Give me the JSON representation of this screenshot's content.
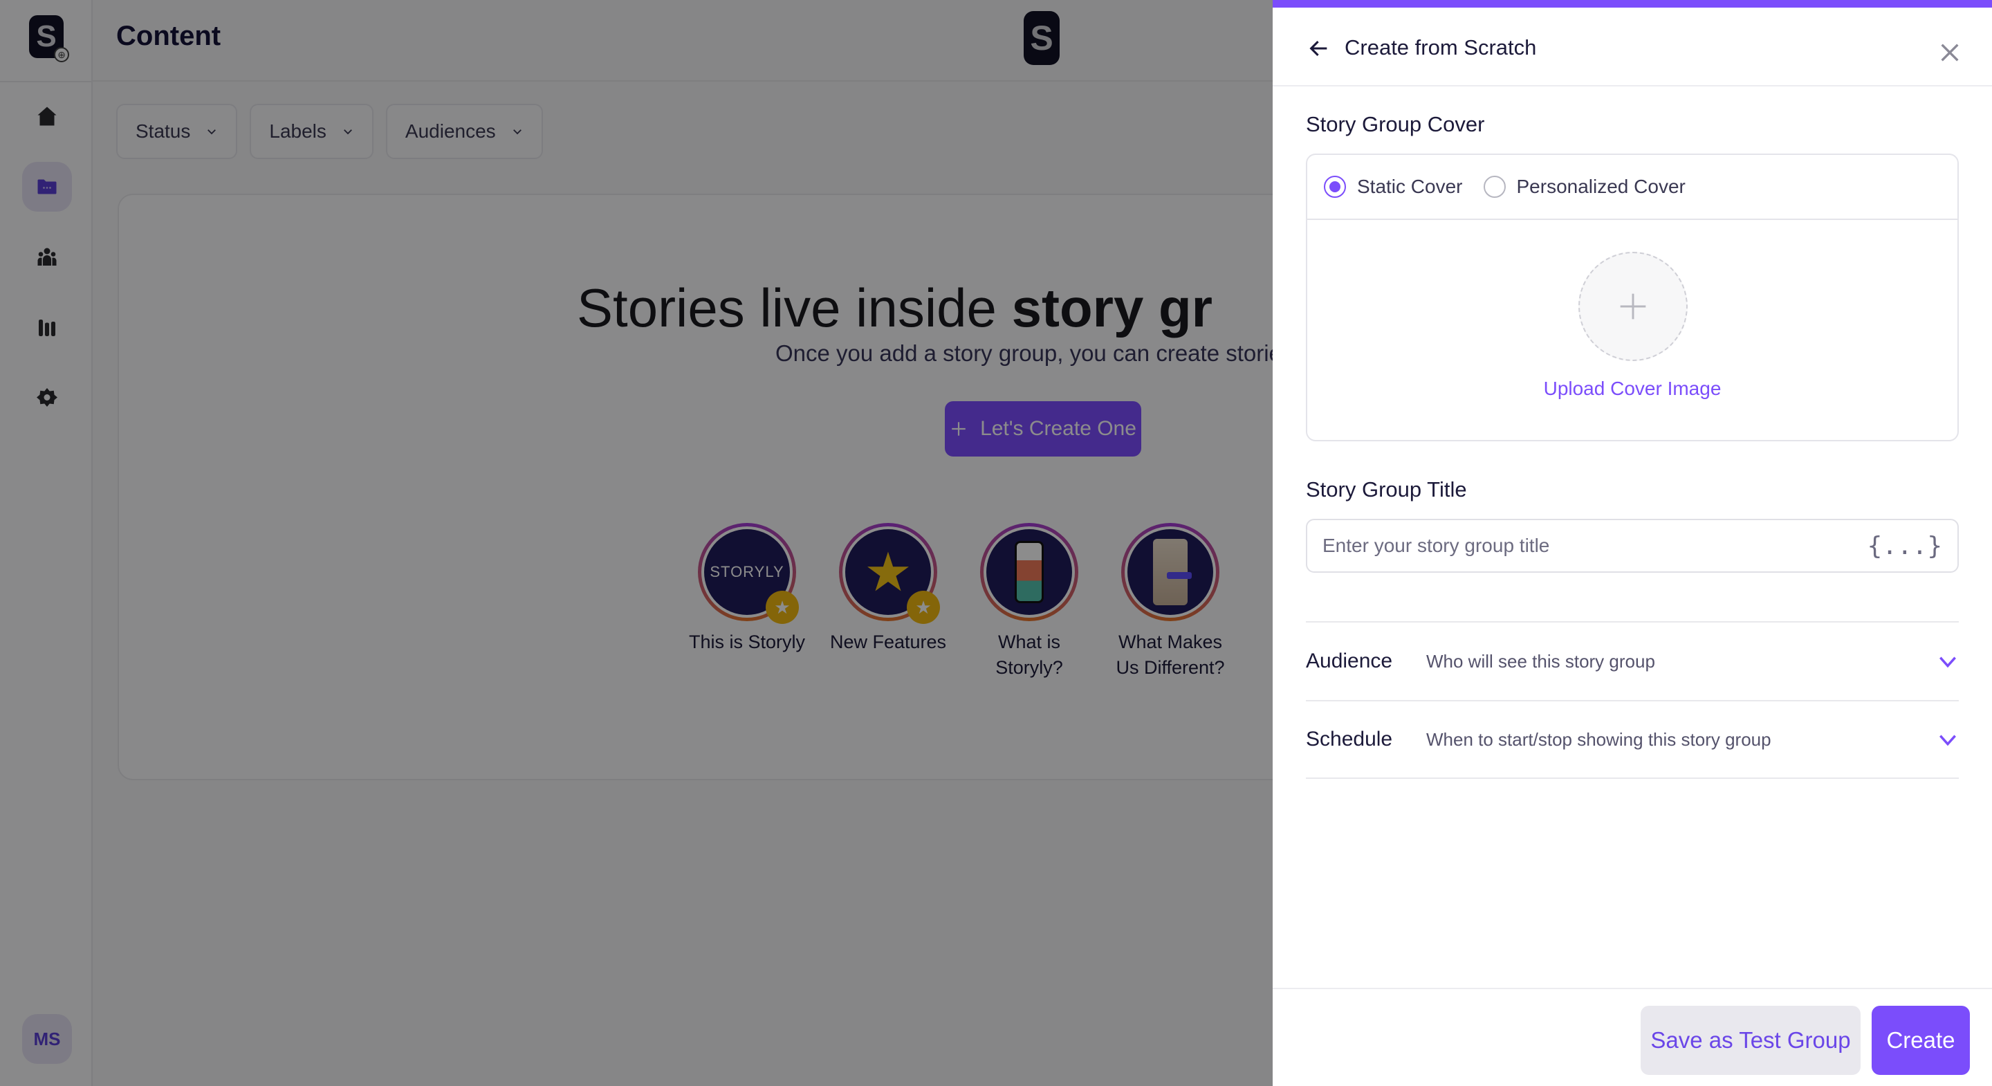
{
  "app": {
    "page_title": "Content",
    "user_initials": "MS",
    "brand_letter": "S"
  },
  "sidebar": {
    "items": [
      {
        "name": "home",
        "icon": "home-icon",
        "active": false
      },
      {
        "name": "content",
        "icon": "folder-icon",
        "active": true
      },
      {
        "name": "audiences",
        "icon": "users-icon",
        "active": false
      },
      {
        "name": "analytics",
        "icon": "bar-chart-icon",
        "active": false
      },
      {
        "name": "settings",
        "icon": "gear-icon",
        "active": false
      }
    ]
  },
  "filters": [
    {
      "label": "Status"
    },
    {
      "label": "Labels"
    },
    {
      "label": "Audiences"
    }
  ],
  "empty_state": {
    "title_regular": "Stories live inside ",
    "title_bold": "story gr",
    "subtitle": "Once you add a story group, you can create stories",
    "cta_label": "Let's Create One"
  },
  "story_groups": [
    {
      "label": "This is Storyly",
      "thumb_text": "STORYLY",
      "has_badge": true
    },
    {
      "label": "New Features",
      "thumb_text": "★",
      "has_badge": true
    },
    {
      "label": "What is Storyly?",
      "thumb_text": "",
      "has_badge": false
    },
    {
      "label": "What Makes Us Different?",
      "thumb_text": "",
      "has_badge": false
    }
  ],
  "drawer": {
    "title": "Create from Scratch",
    "cover_section_label": "Story Group Cover",
    "cover_options": [
      {
        "label": "Static Cover",
        "checked": true
      },
      {
        "label": "Personalized Cover",
        "checked": false
      }
    ],
    "upload_label": "Upload Cover Image",
    "title_section_label": "Story Group Title",
    "title_input": {
      "value": "",
      "placeholder": "Enter your story group title"
    },
    "variable_icon_text": "{...}",
    "accordions": [
      {
        "label": "Audience",
        "description": "Who will see this story group"
      },
      {
        "label": "Schedule",
        "description": "When to start/stop showing this story group"
      }
    ],
    "save_test_label": "Save as Test Group",
    "create_label": "Create"
  },
  "colors": {
    "accent": "#7b4dfb",
    "overlay": "rgba(0,0,0,0.45)"
  }
}
